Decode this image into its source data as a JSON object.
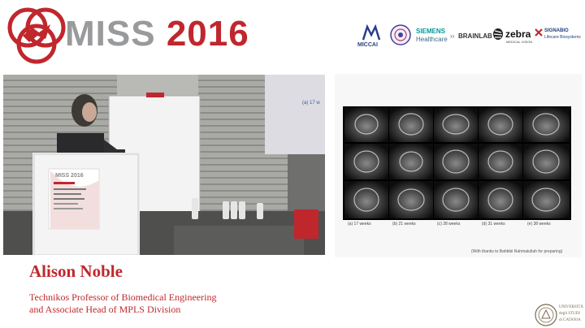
{
  "event": {
    "name_part1": "MISS",
    "name_part2": "2016"
  },
  "sponsors": [
    {
      "name": "MICCAI"
    },
    {
      "name": "SIEMENS",
      "sub": "Healthcare"
    },
    {
      "name": "BRAINLAB"
    },
    {
      "name": "zebra",
      "sub": "MEDICAL VISION"
    },
    {
      "name": "SIGNABIO",
      "sub": "Lifecare Biosystems"
    }
  ],
  "video": {
    "top_slide_caption": "(a) 17 w",
    "mini_poster_title": "MISS 2016"
  },
  "slide": {
    "captions": [
      "(a) 17 weeks",
      "(b) 21 weeks",
      "(c) 28 weeks",
      "(d) 31 weeks",
      "(e) 38 weeks"
    ],
    "credit": "(With thanks to Bahbibi Rahmatullah for preparing)"
  },
  "speaker": {
    "name": "Alison Noble",
    "title_line1": "Technikos Professor of Biomedical Engineering",
    "title_line2": "and Associate Head of MPLS Division"
  },
  "footer": {
    "seal_line1": "UNIVERSITÀ",
    "seal_line2": "degli STUDI",
    "seal_line3": "di CATANIA"
  },
  "colors": {
    "accent": "#c0272d",
    "grey": "#999a9c"
  }
}
